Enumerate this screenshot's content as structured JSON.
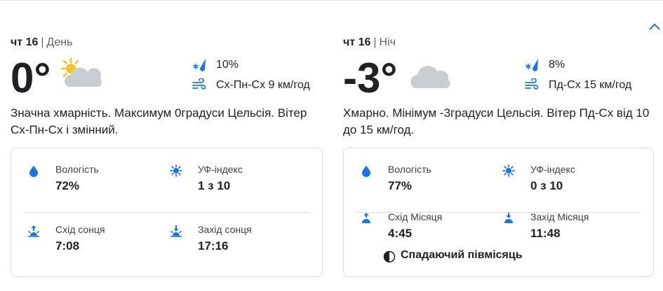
{
  "day_panel": {
    "day": "чт 16",
    "separator": "|",
    "period": "День",
    "temperature": "0°",
    "condition_icon": "partly-cloudy-icon",
    "precipitation": "10%",
    "wind": "Сх-Пн-Сх 9 км/год",
    "summary": "Значна хмарність. Максимум 0градуси Цельсія. Вітер Сх-Пн-Сх і змінний.",
    "details": {
      "humidity_label": "Вологість",
      "humidity_value": "72%",
      "uv_label": "УФ-індекс",
      "uv_value": "1 з 10",
      "rise_label": "Схід сонця",
      "rise_value": "7:08",
      "set_label": "Захід сонця",
      "set_value": "17:16"
    }
  },
  "night_panel": {
    "day": "чт 16",
    "separator": "|",
    "period": "Ніч",
    "temperature": "-3°",
    "condition_icon": "cloudy-icon",
    "precipitation": "8%",
    "wind": "Пд-Сх 15 км/год",
    "summary": "Хмарно. Мінімум -3градуси Цельсія. Вітер Пд-Сх від 10 до 15 км/год.",
    "details": {
      "humidity_label": "Вологість",
      "humidity_value": "77%",
      "uv_label": "УФ-індекс",
      "uv_value": "0 з 10",
      "rise_label": "Схід Місяця",
      "rise_value": "4:45",
      "set_label": "Захід Місяця",
      "set_value": "11:48",
      "moon_phase": "Спадаючий півмісяць"
    }
  },
  "colors": {
    "accent_blue": "#1a73e8",
    "text_primary": "#202124",
    "text_secondary": "#5f6368",
    "border": "#dadce0",
    "sun": "#f6c02a",
    "cloud": "#c9cdd1"
  }
}
